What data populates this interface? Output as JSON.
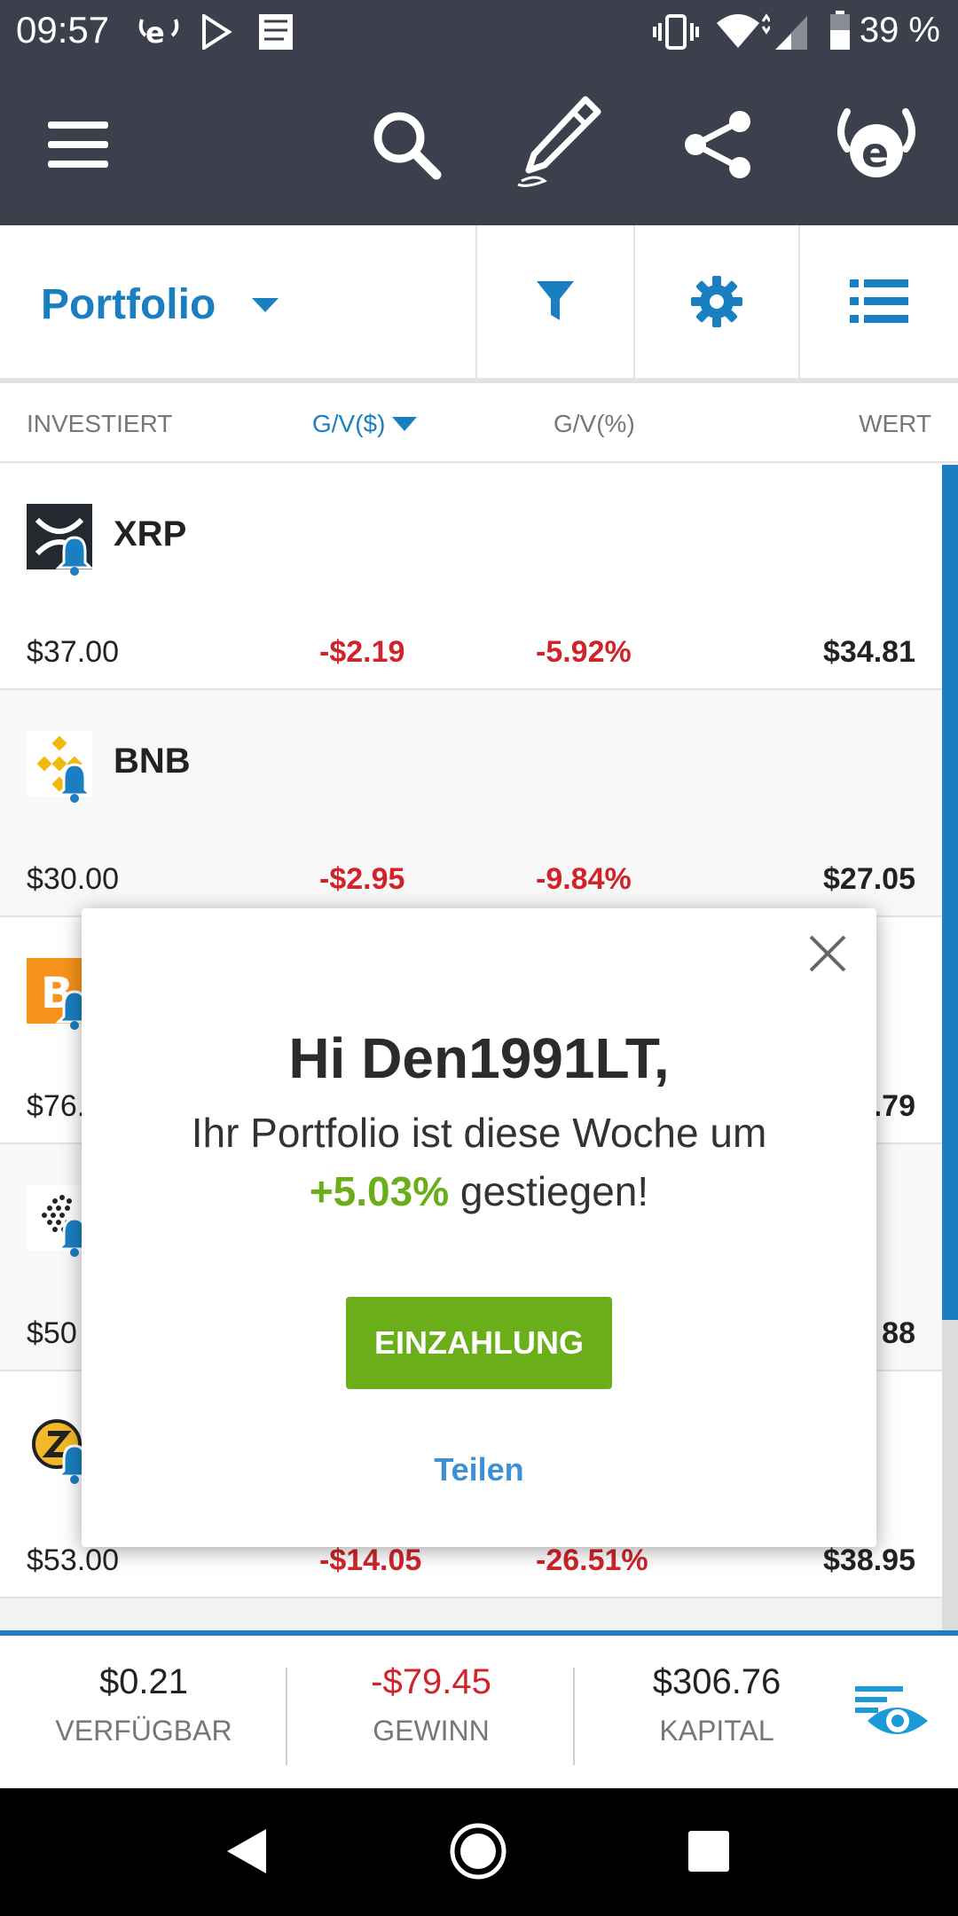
{
  "status_bar": {
    "time": "09:57",
    "battery": "39 %"
  },
  "toolbar": {
    "portfolio_label": "Portfolio"
  },
  "columns": {
    "invested": "INVESTIERT",
    "gv_dollar": "G/V($)",
    "gv_percent": "G/V(%)",
    "value": "WERT"
  },
  "rows": [
    {
      "name": "XRP",
      "invested": "$37.00",
      "gv": "-$2.19",
      "gvp": "-5.92%",
      "value": "$34.81"
    },
    {
      "name": "BNB",
      "invested": "$30.00",
      "gv": "-$2.95",
      "gvp": "-9.84%",
      "value": "$27.05"
    },
    {
      "invested": "$76.",
      "value": ".79"
    },
    {
      "invested": "$50",
      "value": "88"
    },
    {
      "invested": "$53.00",
      "gv": "-$14.05",
      "gvp": "-26.51%",
      "value": "$38.95"
    }
  ],
  "summary": {
    "available_value": "$0.21",
    "available_label": "VERFÜGBAR",
    "profit_value": "-$79.45",
    "profit_label": "GEWINN",
    "capital_value": "$306.76",
    "capital_label": "KAPITAL"
  },
  "dialog": {
    "greeting": "Hi Den1991LT,",
    "line1": "Ihr Portfolio ist diese Woche um",
    "percent": "+5.03%",
    "line2_rest": " gestiegen!",
    "deposit_label": "EINZAHLUNG",
    "share_label": "Teilen"
  },
  "colors": {
    "brand_blue": "#1a7fc1",
    "app_bar": "#3c404c",
    "loss_red": "#d0242a",
    "gain_green": "#6aae1a"
  }
}
